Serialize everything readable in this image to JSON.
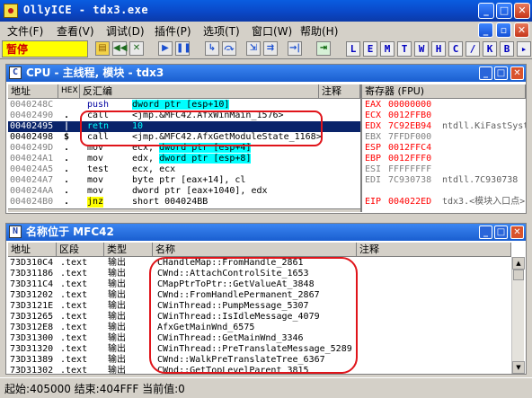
{
  "app": {
    "title": "OllyICE - tdx3.exe"
  },
  "menu": [
    "文件(F)",
    "查看(V)",
    "调试(D)",
    "插件(P)",
    "选项(T)",
    "窗口(W)",
    "帮助(H)"
  ],
  "toolbar": {
    "status": "暂停",
    "letters": [
      "L",
      "E",
      "M",
      "T",
      "W",
      "H",
      "C",
      "/",
      "K",
      "B"
    ]
  },
  "cpu": {
    "title": "CPU - 主线程, 模块 - tdx3",
    "headers": {
      "addr": "地址",
      "hex": "HEX",
      "disasm": "反汇编",
      "comment": "注释",
      "regs": "寄存器 (FPU)"
    },
    "rows": [
      {
        "addr": "0040248C",
        "mark": "",
        "instr": "push",
        "op": "dword ptr [esp+10]",
        "op_hl": true,
        "addr_color": "#808080"
      },
      {
        "addr": "00402490",
        "mark": ".",
        "instr": "call",
        "op": "<jmp.&MFC42.AfxWinMain_1576>",
        "op_hl": false,
        "addr_color": "#808080"
      },
      {
        "addr": "00402495",
        "mark": "|",
        "instr": "retn",
        "op": "10",
        "op_hl": false,
        "addr_color": "#000000",
        "selected": true
      },
      {
        "addr": "00402498",
        "mark": "$",
        "instr": "call",
        "op": "<jmp.&MFC42.AfxGetModuleState_1168>",
        "op_hl": false,
        "addr_color": "#000000"
      },
      {
        "addr": "0040249D",
        "mark": ".",
        "instr": "mov",
        "op_pre": "ecx, ",
        "op": "dword ptr [esp+4]",
        "op_hl": true,
        "addr_color": "#808080"
      },
      {
        "addr": "004024A1",
        "mark": ".",
        "instr": "mov",
        "op_pre": "edx, ",
        "op": "dword ptr [esp+8]",
        "op_hl": true,
        "addr_color": "#808080"
      },
      {
        "addr": "004024A5",
        "mark": ".",
        "instr": "test",
        "op": "ecx, ecx",
        "op_hl": false,
        "addr_color": "#808080"
      },
      {
        "addr": "004024A7",
        "mark": ".",
        "instr": "mov",
        "op": "byte ptr [eax+14], cl",
        "op_hl": false,
        "addr_color": "#808080"
      },
      {
        "addr": "004024AA",
        "mark": ".",
        "instr": "mov",
        "op": "dword ptr [eax+1040], edx",
        "op_hl": false,
        "addr_color": "#808080"
      },
      {
        "addr": "004024B0",
        "mark": ".",
        "instr": "jnz",
        "op": "short 004024BB",
        "op_hl": false,
        "addr_color": "#808080"
      }
    ],
    "registers": [
      {
        "name": "EAX",
        "value": "00000000",
        "extra": "",
        "color": "#ff0000"
      },
      {
        "name": "ECX",
        "value": "0012FFB0",
        "extra": "",
        "color": "#ff0000"
      },
      {
        "name": "EDX",
        "value": "7C92EB94",
        "extra": "ntdll.KiFastSystemCallRet",
        "color": "#ff0000"
      },
      {
        "name": "EBX",
        "value": "7FFDF000",
        "extra": "",
        "color": "#808080"
      },
      {
        "name": "ESP",
        "value": "0012FFC4",
        "extra": "",
        "color": "#ff0000"
      },
      {
        "name": "EBP",
        "value": "0012FFF0",
        "extra": "",
        "color": "#ff0000"
      },
      {
        "name": "ESI",
        "value": "FFFFFFFF",
        "extra": "",
        "color": "#808080"
      },
      {
        "name": "EDI",
        "value": "7C930738",
        "extra": "ntdll.7C930738",
        "color": "#808080"
      },
      {
        "name": "",
        "value": "",
        "extra": "",
        "color": "#808080"
      },
      {
        "name": "EIP",
        "value": "004022ED",
        "extra": "tdx3.<模块入口点>",
        "color": "#ff0000"
      }
    ]
  },
  "names": {
    "title": "名称位于 MFC42",
    "headers": {
      "addr": "地址",
      "section": "区段",
      "type": "类型",
      "name": "名称",
      "comment": "注释"
    },
    "rows": [
      {
        "addr": "73D310C4",
        "section": ".text",
        "type": "输出",
        "name": "CHandleMap::FromHandle_2861"
      },
      {
        "addr": "73D31186",
        "section": ".text",
        "type": "输出",
        "name": "CWnd::AttachControlSite_1653"
      },
      {
        "addr": "73D311C4",
        "section": ".text",
        "type": "输出",
        "name": "CMapPtrToPtr::GetValueAt_3848"
      },
      {
        "addr": "73D31202",
        "section": ".text",
        "type": "输出",
        "name": "CWnd::FromHandlePermanent_2867"
      },
      {
        "addr": "73D3121E",
        "section": ".text",
        "type": "输出",
        "name": "CWinThread::PumpMessage_5307"
      },
      {
        "addr": "73D31265",
        "section": ".text",
        "type": "输出",
        "name": "CWinThread::IsIdleMessage_4079"
      },
      {
        "addr": "73D312E8",
        "section": ".text",
        "type": "输出",
        "name": "AfxGetMainWnd_6575"
      },
      {
        "addr": "73D31300",
        "section": ".text",
        "type": "输出",
        "name": "CWinThread::GetMainWnd_3346"
      },
      {
        "addr": "73D31320",
        "section": ".text",
        "type": "输出",
        "name": "CWinThread::PreTranslateMessage_5289"
      },
      {
        "addr": "73D31389",
        "section": ".text",
        "type": "输出",
        "name": "CWnd::WalkPreTranslateTree_6367"
      },
      {
        "addr": "73D31302",
        "section": ".text",
        "type": "输出",
        "name": "CWnd::GetTopLevelParent_3815"
      }
    ]
  },
  "status": {
    "text": "起始:405000 结束:404FFF 当前值:0"
  },
  "colors": {
    "annotation_red": "#e0141a",
    "highlight_cyan": "#00ffff",
    "selection": "#0a246a"
  }
}
